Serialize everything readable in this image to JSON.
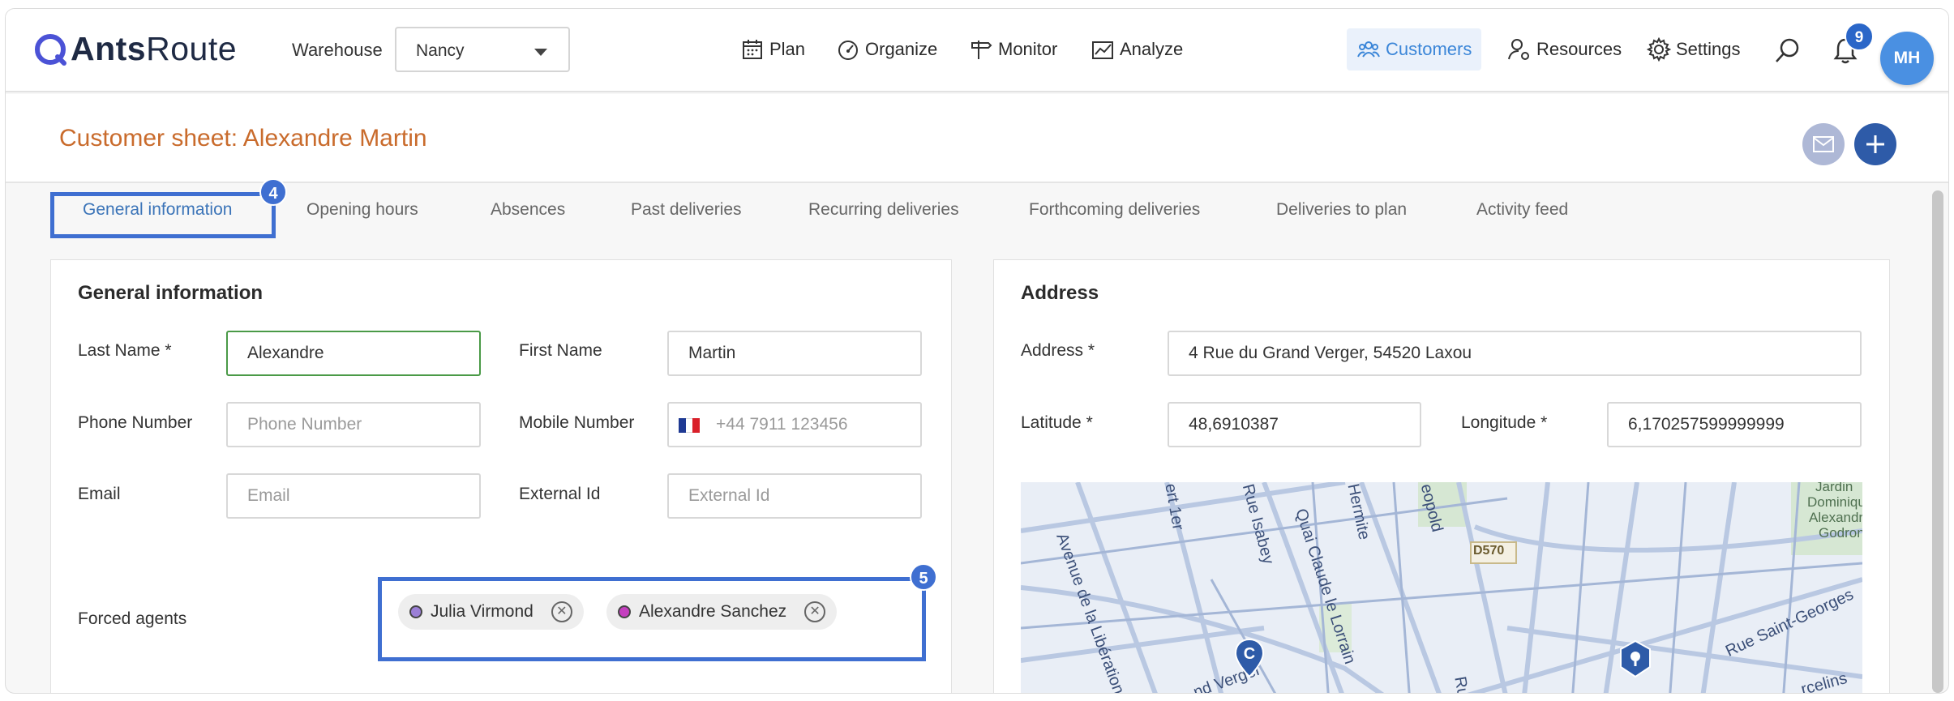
{
  "app": {
    "logo_bold": "Ants",
    "logo_light": "Route"
  },
  "topbar": {
    "warehouse_label": "Warehouse",
    "warehouse_value": "Nancy",
    "nav": [
      "Plan",
      "Organize",
      "Monitor",
      "Analyze"
    ],
    "customers": "Customers",
    "resources": "Resources",
    "settings": "Settings",
    "notifications_count": "9",
    "avatar_initials": "MH"
  },
  "header": {
    "title": "Customer sheet: Alexandre Martin"
  },
  "tabs": [
    "General information",
    "Opening hours",
    "Absences",
    "Past deliveries",
    "Recurring deliveries",
    "Forthcoming deliveries",
    "Deliveries to plan",
    "Activity feed"
  ],
  "highlights": {
    "tab_badge": "4",
    "agents_badge": "5"
  },
  "general": {
    "title": "General information",
    "last_name_label": "Last Name *",
    "last_name_value": "Alexandre",
    "first_name_label": "First Name",
    "first_name_value": "Martin",
    "phone_label": "Phone Number",
    "phone_placeholder": "Phone Number",
    "mobile_label": "Mobile Number",
    "mobile_placeholder": "+44 7911 123456",
    "email_label": "Email",
    "email_placeholder": "Email",
    "external_label": "External Id",
    "external_placeholder": "External Id",
    "forced_label": "Forced agents",
    "agents": [
      {
        "name": "Julia Virmond",
        "color": "#9b7fd6"
      },
      {
        "name": "Alexandre Sanchez",
        "color": "#c43fbf"
      }
    ]
  },
  "address": {
    "title": "Address",
    "address_label": "Address *",
    "address_value": "4 Rue du Grand Verger, 54520 Laxou",
    "latitude_label": "Latitude *",
    "latitude_value": "48,6910387",
    "longitude_label": "Longitude *",
    "longitude_value": "6,170257599999999"
  },
  "map": {
    "labels": [
      "Avenue de la Libération",
      "ert 1er",
      "Rue Isabey",
      "Quai Claude le Lorrain",
      "Hermite",
      "eopold",
      "D570",
      "Rue Saint-Georges",
      "Jardin",
      "Dominique",
      "Alexandre",
      "Godron",
      "nd Verger",
      "Rue",
      "rcelins"
    ],
    "marker_letter": "C"
  },
  "colors": {
    "accent": "#3f6fd1",
    "title_orange": "#c96b2c",
    "primary_blue": "#2e5ba8"
  }
}
